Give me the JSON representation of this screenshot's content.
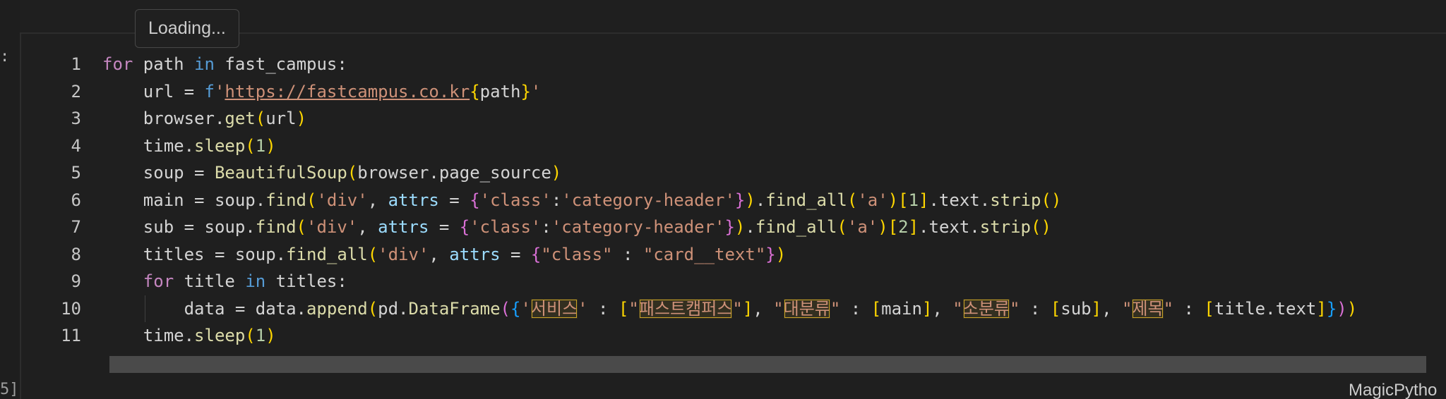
{
  "tooltip": {
    "text": "Loading..."
  },
  "gutter": {
    "left_mark": ":",
    "exec_count": "5]"
  },
  "status": {
    "language_label": "MagicPytho"
  },
  "editor": {
    "lines": [
      {
        "num": "1",
        "tokens": [
          {
            "t": "for",
            "c": "kw"
          },
          {
            "t": " path ",
            "c": "var"
          },
          {
            "t": "in",
            "c": "kw2"
          },
          {
            "t": " fast_campus:",
            "c": "var"
          }
        ]
      },
      {
        "num": "2",
        "tokens": [
          {
            "t": "    url = ",
            "c": "var"
          },
          {
            "t": "f",
            "c": "kw2"
          },
          {
            "t": "'",
            "c": "str"
          },
          {
            "t": "https://fastcampus.co.kr",
            "c": "url"
          },
          {
            "t": "{",
            "c": "b1"
          },
          {
            "t": "path",
            "c": "var"
          },
          {
            "t": "}",
            "c": "b1"
          },
          {
            "t": "'",
            "c": "str"
          }
        ]
      },
      {
        "num": "3",
        "tokens": [
          {
            "t": "    browser.",
            "c": "var"
          },
          {
            "t": "get",
            "c": "fn"
          },
          {
            "t": "(",
            "c": "b1"
          },
          {
            "t": "url",
            "c": "var"
          },
          {
            "t": ")",
            "c": "b1"
          }
        ]
      },
      {
        "num": "4",
        "tokens": [
          {
            "t": "    time.",
            "c": "var"
          },
          {
            "t": "sleep",
            "c": "fn"
          },
          {
            "t": "(",
            "c": "b1"
          },
          {
            "t": "1",
            "c": "num"
          },
          {
            "t": ")",
            "c": "b1"
          }
        ]
      },
      {
        "num": "5",
        "tokens": [
          {
            "t": "    soup = ",
            "c": "var"
          },
          {
            "t": "BeautifulSoup",
            "c": "fn"
          },
          {
            "t": "(",
            "c": "b1"
          },
          {
            "t": "browser.page_source",
            "c": "var"
          },
          {
            "t": ")",
            "c": "b1"
          }
        ]
      },
      {
        "num": "6",
        "tokens": [
          {
            "t": "    main = soup.",
            "c": "var"
          },
          {
            "t": "find",
            "c": "fn"
          },
          {
            "t": "(",
            "c": "b1"
          },
          {
            "t": "'div'",
            "c": "str"
          },
          {
            "t": ", ",
            "c": "var"
          },
          {
            "t": "attrs",
            "c": "attr"
          },
          {
            "t": " = ",
            "c": "var"
          },
          {
            "t": "{",
            "c": "b2"
          },
          {
            "t": "'class'",
            "c": "str"
          },
          {
            "t": ":",
            "c": "var"
          },
          {
            "t": "'category-header'",
            "c": "str"
          },
          {
            "t": "}",
            "c": "b2"
          },
          {
            "t": ")",
            "c": "b1"
          },
          {
            "t": ".",
            "c": "var"
          },
          {
            "t": "find_all",
            "c": "fn"
          },
          {
            "t": "(",
            "c": "b1"
          },
          {
            "t": "'a'",
            "c": "str"
          },
          {
            "t": ")",
            "c": "b1"
          },
          {
            "t": "[",
            "c": "b1"
          },
          {
            "t": "1",
            "c": "num"
          },
          {
            "t": "]",
            "c": "b1"
          },
          {
            "t": ".text.",
            "c": "var"
          },
          {
            "t": "strip",
            "c": "fn"
          },
          {
            "t": "()",
            "c": "b1"
          }
        ]
      },
      {
        "num": "7",
        "tokens": [
          {
            "t": "    sub = soup.",
            "c": "var"
          },
          {
            "t": "find",
            "c": "fn"
          },
          {
            "t": "(",
            "c": "b1"
          },
          {
            "t": "'div'",
            "c": "str"
          },
          {
            "t": ", ",
            "c": "var"
          },
          {
            "t": "attrs",
            "c": "attr"
          },
          {
            "t": " = ",
            "c": "var"
          },
          {
            "t": "{",
            "c": "b2"
          },
          {
            "t": "'class'",
            "c": "str"
          },
          {
            "t": ":",
            "c": "var"
          },
          {
            "t": "'category-header'",
            "c": "str"
          },
          {
            "t": "}",
            "c": "b2"
          },
          {
            "t": ")",
            "c": "b1"
          },
          {
            "t": ".",
            "c": "var"
          },
          {
            "t": "find_all",
            "c": "fn"
          },
          {
            "t": "(",
            "c": "b1"
          },
          {
            "t": "'a'",
            "c": "str"
          },
          {
            "t": ")",
            "c": "b1"
          },
          {
            "t": "[",
            "c": "b1"
          },
          {
            "t": "2",
            "c": "num"
          },
          {
            "t": "]",
            "c": "b1"
          },
          {
            "t": ".text.",
            "c": "var"
          },
          {
            "t": "strip",
            "c": "fn"
          },
          {
            "t": "()",
            "c": "b1"
          }
        ]
      },
      {
        "num": "8",
        "tokens": [
          {
            "t": "    titles = soup.",
            "c": "var"
          },
          {
            "t": "find_all",
            "c": "fn"
          },
          {
            "t": "(",
            "c": "b1"
          },
          {
            "t": "'div'",
            "c": "str"
          },
          {
            "t": ", ",
            "c": "var"
          },
          {
            "t": "attrs",
            "c": "attr"
          },
          {
            "t": " = ",
            "c": "var"
          },
          {
            "t": "{",
            "c": "b2"
          },
          {
            "t": "\"class\"",
            "c": "str"
          },
          {
            "t": " : ",
            "c": "var"
          },
          {
            "t": "\"card__text\"",
            "c": "str"
          },
          {
            "t": "}",
            "c": "b2"
          },
          {
            "t": ")",
            "c": "b1"
          }
        ]
      },
      {
        "num": "9",
        "tokens": [
          {
            "t": "    ",
            "c": "var"
          },
          {
            "t": "for",
            "c": "kw"
          },
          {
            "t": " title ",
            "c": "var"
          },
          {
            "t": "in",
            "c": "kw2"
          },
          {
            "t": " titles:",
            "c": "var"
          }
        ]
      },
      {
        "num": "10",
        "guide": true,
        "tokens": [
          {
            "t": "        data = data.",
            "c": "var"
          },
          {
            "t": "append",
            "c": "fn"
          },
          {
            "t": "(",
            "c": "b1"
          },
          {
            "t": "pd.",
            "c": "var"
          },
          {
            "t": "DataFrame",
            "c": "fn"
          },
          {
            "t": "(",
            "c": "b2"
          },
          {
            "t": "{",
            "c": "b3"
          },
          {
            "t": "'",
            "c": "str"
          },
          {
            "t": "서비스",
            "c": "str",
            "hl": true
          },
          {
            "t": "'",
            "c": "str"
          },
          {
            "t": " : ",
            "c": "var"
          },
          {
            "t": "[",
            "c": "b1"
          },
          {
            "t": "\"",
            "c": "str"
          },
          {
            "t": "패스트캠퍼스",
            "c": "str",
            "hl": true
          },
          {
            "t": "\"",
            "c": "str"
          },
          {
            "t": "]",
            "c": "b1"
          },
          {
            "t": ", ",
            "c": "var"
          },
          {
            "t": "\"",
            "c": "str"
          },
          {
            "t": "대분류",
            "c": "str",
            "hl": true
          },
          {
            "t": "\"",
            "c": "str"
          },
          {
            "t": " : ",
            "c": "var"
          },
          {
            "t": "[",
            "c": "b1"
          },
          {
            "t": "main",
            "c": "var"
          },
          {
            "t": "]",
            "c": "b1"
          },
          {
            "t": ", ",
            "c": "var"
          },
          {
            "t": "\"",
            "c": "str"
          },
          {
            "t": "소분류",
            "c": "str",
            "hl": true
          },
          {
            "t": "\"",
            "c": "str"
          },
          {
            "t": " : ",
            "c": "var"
          },
          {
            "t": "[",
            "c": "b1"
          },
          {
            "t": "sub",
            "c": "var"
          },
          {
            "t": "]",
            "c": "b1"
          },
          {
            "t": ", ",
            "c": "var"
          },
          {
            "t": "\"",
            "c": "str"
          },
          {
            "t": "제목",
            "c": "str",
            "hl": true
          },
          {
            "t": "\"",
            "c": "str"
          },
          {
            "t": " : ",
            "c": "var"
          },
          {
            "t": "[",
            "c": "b1"
          },
          {
            "t": "title.text",
            "c": "var"
          },
          {
            "t": "]",
            "c": "b1"
          },
          {
            "t": "}",
            "c": "b3"
          },
          {
            "t": ")",
            "c": "b2"
          },
          {
            "t": ")",
            "c": "b1"
          }
        ]
      },
      {
        "num": "11",
        "tokens": [
          {
            "t": "    time.",
            "c": "var"
          },
          {
            "t": "sleep",
            "c": "fn"
          },
          {
            "t": "(",
            "c": "b1"
          },
          {
            "t": "1",
            "c": "num"
          },
          {
            "t": ")",
            "c": "b1"
          }
        ]
      }
    ]
  },
  "colors": {
    "background": "#1f1f1f",
    "keyword": "#c586c0",
    "keyword_blue": "#569cd6",
    "string": "#ce9178",
    "function": "#dcdcaa",
    "number": "#b5cea8",
    "bracket_1": "#ffd700",
    "bracket_2": "#da70d6",
    "bracket_3": "#179fff",
    "highlight_border": "#c9a227"
  }
}
